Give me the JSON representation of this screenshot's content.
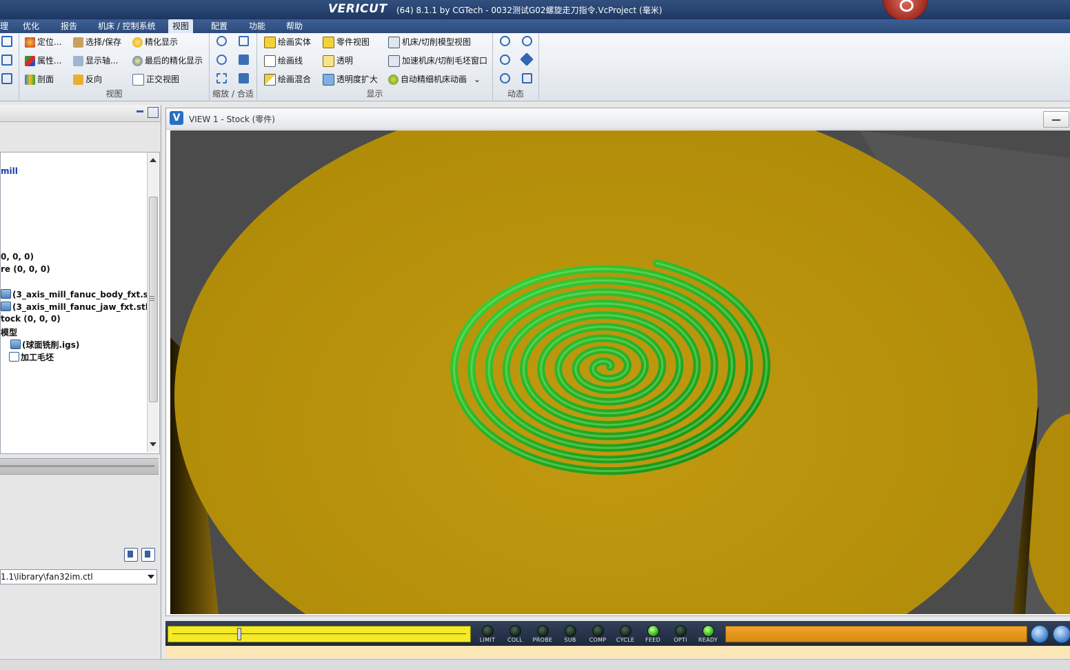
{
  "window": {
    "logo": "VERICUT",
    "title": "(64)  8.1.1 by CGTech - 0032测试G02螺旋走刀指令.VcProject (毫米)"
  },
  "menu": [
    "理",
    "优化",
    "报告",
    "机床 / 控制系统",
    "视图",
    "配置",
    "功能",
    "帮助"
  ],
  "ribbon": {
    "view_group": {
      "label": "视图",
      "locate": "定位...",
      "select_save": "选择/保存",
      "refine_display": "精化显示",
      "properties": "属性...",
      "show_axes": "显示轴...",
      "last_refine": "最后的精化显示",
      "section": "剖面",
      "reverse": "反向",
      "ortho_view": "正交视图"
    },
    "zoom_group": {
      "label": "缩放 / 合适"
    },
    "display_group": {
      "label": "显示",
      "draw_solid": "绘画实体",
      "part_view": "零件视图",
      "machine_cut_view": "机床/切削模型视图",
      "draw_lines": "绘画线",
      "transparent": "透明",
      "accelerate": "加速机床/切削毛坯窗口",
      "draw_mixed": "绘画混合",
      "transparency_expand": "透明度扩大",
      "auto_refine": "自动精细机床动画"
    },
    "dynamic_group": {
      "label": "动态"
    }
  },
  "tree": {
    "lines": [
      "mill",
      "0, 0, 0)",
      "re (0, 0, 0)",
      "(3_axis_mill_fanuc_body_fxt.stl)",
      "(3_axis_mill_fanuc_jaw_fxt.stl)",
      "tock (0, 0, 0)",
      "模型",
      "(球面铣削.igs)",
      "加工毛坯"
    ]
  },
  "control_file": "1.1\\library\\fan32im.ctl",
  "view": {
    "title": "VIEW 1 - Stock (零件)"
  },
  "status": {
    "progress_fraction": 0.22,
    "lights": [
      {
        "label": "LIMIT",
        "on": false
      },
      {
        "label": "COLL",
        "on": false
      },
      {
        "label": "PROBE",
        "on": false
      },
      {
        "label": "SUB",
        "on": false
      },
      {
        "label": "COMP",
        "on": false
      },
      {
        "label": "CYCLE",
        "on": false
      },
      {
        "label": "FEED",
        "on": true
      },
      {
        "label": "OPTI",
        "on": false
      },
      {
        "label": "READY",
        "on": true
      }
    ]
  },
  "colors": {
    "stock": "#b8900a",
    "toolpath": "#22b41c",
    "background": "#4b4b4b",
    "progress": "#f5ea26",
    "orange_bar": "#e39a1e"
  }
}
